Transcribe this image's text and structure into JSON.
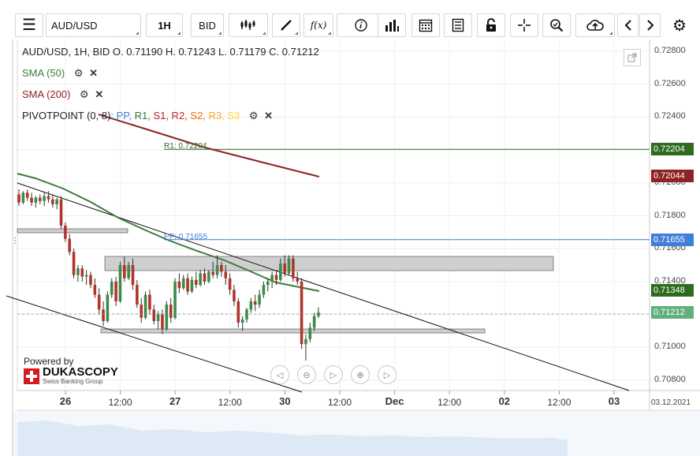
{
  "toolbar": {
    "symbol": "AUD/USD",
    "timeframe": "1H",
    "side": "BID",
    "fx_label": "f(x)"
  },
  "legend": {
    "ohlc_line": "AUD/USD, 1H, BID    O. 0.71190 H. 0.71243 L. 0.71179 C. 0.71212",
    "sma50": "SMA (50)",
    "sma200": "SMA (200)",
    "pivot_label": "PIVOTPOINT (0, 8)",
    "pivot_items": [
      {
        "text": ": PP,",
        "color": "#3a7bd5"
      },
      {
        "text": " R1,",
        "color": "#2e7d32"
      },
      {
        "text": " S1,",
        "color": "#b71c1c"
      },
      {
        "text": " R2,",
        "color": "#c62828"
      },
      {
        "text": " S2,",
        "color": "#ef6c00"
      },
      {
        "text": " R3,",
        "color": "#f9a825"
      },
      {
        "text": " S3",
        "color": "#fdd835"
      }
    ]
  },
  "branding": {
    "powered_by": "Powered by",
    "name": "DUKASCOPY",
    "tagline": "Swiss Banking Group"
  },
  "chart_data": {
    "type": "candlestick",
    "title": "AUD/USD, 1H, BID",
    "ohlc_current": {
      "open": 0.7119,
      "high": 0.71243,
      "low": 0.71179,
      "close": 0.71212
    },
    "ylim": [
      0.7072,
      0.729
    ],
    "y_ticks": [
      0.728,
      0.726,
      0.724,
      0.722,
      0.72,
      0.718,
      0.716,
      0.714,
      0.712,
      0.71,
      0.708
    ],
    "y_tick_labels": [
      "0.72800",
      "0.72600",
      "0.72400",
      "0.72200",
      "0.72000",
      "0.71800",
      "0.71600",
      "0.71400",
      "0.71200",
      "0.71000",
      "0.70800"
    ],
    "x_labels": [
      "26",
      "12:00",
      "27",
      "12:00",
      "30",
      "12:00",
      "Dec",
      "12:00",
      "02",
      "12:00",
      "03"
    ],
    "x_label_major": [
      true,
      false,
      true,
      false,
      true,
      false,
      true,
      false,
      true,
      false,
      true
    ],
    "date_stamp": "03.12.2021",
    "pivot_levels": {
      "R1": 0.72204,
      "PP": 0.71655
    },
    "pivot_level_labels": {
      "R1": "R1: 0.72204",
      "PP": "PP: 0.71655"
    },
    "price_markers": [
      {
        "label": "0.72204",
        "value": 0.72204,
        "color": "#2f6b1f"
      },
      {
        "label": "0.72044",
        "value": 0.72044,
        "color": "#8e2323"
      },
      {
        "label": "0.71655",
        "value": 0.71655,
        "color": "#3f7fd6"
      },
      {
        "label": "0.71348",
        "value": 0.71348,
        "color": "#2f6b1f"
      },
      {
        "label": "0.71212",
        "value": 0.71212,
        "color": "#61b07c"
      }
    ],
    "candles": [
      {
        "o": 0.7193,
        "h": 0.7196,
        "l": 0.7186,
        "c": 0.7188
      },
      {
        "o": 0.7188,
        "h": 0.7195,
        "l": 0.7187,
        "c": 0.7194
      },
      {
        "o": 0.7194,
        "h": 0.7196,
        "l": 0.7189,
        "c": 0.7191
      },
      {
        "o": 0.7191,
        "h": 0.7194,
        "l": 0.7186,
        "c": 0.7188
      },
      {
        "o": 0.7188,
        "h": 0.7192,
        "l": 0.7185,
        "c": 0.7191
      },
      {
        "o": 0.7191,
        "h": 0.7193,
        "l": 0.7187,
        "c": 0.7189
      },
      {
        "o": 0.7189,
        "h": 0.7194,
        "l": 0.7186,
        "c": 0.7192
      },
      {
        "o": 0.7192,
        "h": 0.7195,
        "l": 0.7188,
        "c": 0.719
      },
      {
        "o": 0.719,
        "h": 0.7193,
        "l": 0.7185,
        "c": 0.7187
      },
      {
        "o": 0.7187,
        "h": 0.7191,
        "l": 0.7184,
        "c": 0.719
      },
      {
        "o": 0.719,
        "h": 0.7192,
        "l": 0.7172,
        "c": 0.7174
      },
      {
        "o": 0.7174,
        "h": 0.7176,
        "l": 0.7164,
        "c": 0.7166
      },
      {
        "o": 0.7166,
        "h": 0.7169,
        "l": 0.7156,
        "c": 0.7158
      },
      {
        "o": 0.7158,
        "h": 0.716,
        "l": 0.7142,
        "c": 0.7144
      },
      {
        "o": 0.7144,
        "h": 0.715,
        "l": 0.714,
        "c": 0.7148
      },
      {
        "o": 0.7148,
        "h": 0.715,
        "l": 0.714,
        "c": 0.7143
      },
      {
        "o": 0.7143,
        "h": 0.7147,
        "l": 0.7138,
        "c": 0.7144
      },
      {
        "o": 0.7144,
        "h": 0.7146,
        "l": 0.7136,
        "c": 0.7138
      },
      {
        "o": 0.7138,
        "h": 0.7142,
        "l": 0.713,
        "c": 0.7132
      },
      {
        "o": 0.7132,
        "h": 0.7136,
        "l": 0.712,
        "c": 0.7123
      },
      {
        "o": 0.7123,
        "h": 0.7128,
        "l": 0.7113,
        "c": 0.7116
      },
      {
        "o": 0.7116,
        "h": 0.7134,
        "l": 0.7115,
        "c": 0.7132
      },
      {
        "o": 0.7132,
        "h": 0.7142,
        "l": 0.713,
        "c": 0.714
      },
      {
        "o": 0.714,
        "h": 0.7143,
        "l": 0.7125,
        "c": 0.7128
      },
      {
        "o": 0.7128,
        "h": 0.7152,
        "l": 0.7127,
        "c": 0.715
      },
      {
        "o": 0.715,
        "h": 0.7155,
        "l": 0.714,
        "c": 0.7142
      },
      {
        "o": 0.7142,
        "h": 0.7152,
        "l": 0.7141,
        "c": 0.715
      },
      {
        "o": 0.715,
        "h": 0.7154,
        "l": 0.7135,
        "c": 0.7138
      },
      {
        "o": 0.7138,
        "h": 0.7141,
        "l": 0.7124,
        "c": 0.7126
      },
      {
        "o": 0.7126,
        "h": 0.713,
        "l": 0.7115,
        "c": 0.7118
      },
      {
        "o": 0.7118,
        "h": 0.7134,
        "l": 0.7117,
        "c": 0.7132
      },
      {
        "o": 0.7132,
        "h": 0.7135,
        "l": 0.712,
        "c": 0.7123
      },
      {
        "o": 0.7123,
        "h": 0.7126,
        "l": 0.7114,
        "c": 0.7116
      },
      {
        "o": 0.7116,
        "h": 0.7122,
        "l": 0.7111,
        "c": 0.712
      },
      {
        "o": 0.712,
        "h": 0.7123,
        "l": 0.7108,
        "c": 0.7111
      },
      {
        "o": 0.7111,
        "h": 0.7128,
        "l": 0.711,
        "c": 0.7126
      },
      {
        "o": 0.7126,
        "h": 0.713,
        "l": 0.7115,
        "c": 0.7118
      },
      {
        "o": 0.7118,
        "h": 0.7142,
        "l": 0.7117,
        "c": 0.714
      },
      {
        "o": 0.714,
        "h": 0.7145,
        "l": 0.7133,
        "c": 0.7136
      },
      {
        "o": 0.7136,
        "h": 0.7144,
        "l": 0.7135,
        "c": 0.7142
      },
      {
        "o": 0.7142,
        "h": 0.7145,
        "l": 0.7132,
        "c": 0.7134
      },
      {
        "o": 0.7134,
        "h": 0.7143,
        "l": 0.7133,
        "c": 0.7141
      },
      {
        "o": 0.7141,
        "h": 0.7146,
        "l": 0.7136,
        "c": 0.7138
      },
      {
        "o": 0.7138,
        "h": 0.7147,
        "l": 0.7137,
        "c": 0.7145
      },
      {
        "o": 0.7145,
        "h": 0.7148,
        "l": 0.7138,
        "c": 0.714
      },
      {
        "o": 0.714,
        "h": 0.7147,
        "l": 0.7139,
        "c": 0.7146
      },
      {
        "o": 0.7146,
        "h": 0.7152,
        "l": 0.7142,
        "c": 0.7144
      },
      {
        "o": 0.7144,
        "h": 0.7156,
        "l": 0.7142,
        "c": 0.715
      },
      {
        "o": 0.715,
        "h": 0.7152,
        "l": 0.7143,
        "c": 0.7146
      },
      {
        "o": 0.7146,
        "h": 0.715,
        "l": 0.7138,
        "c": 0.7142
      },
      {
        "o": 0.7142,
        "h": 0.7145,
        "l": 0.7132,
        "c": 0.7135
      },
      {
        "o": 0.7135,
        "h": 0.7138,
        "l": 0.7125,
        "c": 0.7128
      },
      {
        "o": 0.7128,
        "h": 0.713,
        "l": 0.7112,
        "c": 0.7115
      },
      {
        "o": 0.7115,
        "h": 0.7119,
        "l": 0.711,
        "c": 0.7117
      },
      {
        "o": 0.7117,
        "h": 0.7124,
        "l": 0.7115,
        "c": 0.7123
      },
      {
        "o": 0.7123,
        "h": 0.713,
        "l": 0.7121,
        "c": 0.7128
      },
      {
        "o": 0.7128,
        "h": 0.7132,
        "l": 0.7122,
        "c": 0.7126
      },
      {
        "o": 0.7126,
        "h": 0.7135,
        "l": 0.7124,
        "c": 0.7132
      },
      {
        "o": 0.7132,
        "h": 0.714,
        "l": 0.713,
        "c": 0.7138
      },
      {
        "o": 0.7138,
        "h": 0.7142,
        "l": 0.7134,
        "c": 0.714
      },
      {
        "o": 0.714,
        "h": 0.7146,
        "l": 0.7136,
        "c": 0.7144
      },
      {
        "o": 0.7144,
        "h": 0.7147,
        "l": 0.7138,
        "c": 0.7141
      },
      {
        "o": 0.7141,
        "h": 0.7154,
        "l": 0.714,
        "c": 0.7151
      },
      {
        "o": 0.7151,
        "h": 0.7156,
        "l": 0.7143,
        "c": 0.7145
      },
      {
        "o": 0.7145,
        "h": 0.7156,
        "l": 0.7144,
        "c": 0.7154
      },
      {
        "o": 0.7154,
        "h": 0.7156,
        "l": 0.714,
        "c": 0.7142
      },
      {
        "o": 0.7142,
        "h": 0.7146,
        "l": 0.7138,
        "c": 0.714
      },
      {
        "o": 0.714,
        "h": 0.7142,
        "l": 0.7099,
        "c": 0.7102
      },
      {
        "o": 0.7102,
        "h": 0.7108,
        "l": 0.7092,
        "c": 0.7105
      },
      {
        "o": 0.7105,
        "h": 0.7115,
        "l": 0.7103,
        "c": 0.7112
      },
      {
        "o": 0.7112,
        "h": 0.7121,
        "l": 0.711,
        "c": 0.7119
      },
      {
        "o": 0.7119,
        "h": 0.71243,
        "l": 0.71179,
        "c": 0.71212
      }
    ]
  }
}
